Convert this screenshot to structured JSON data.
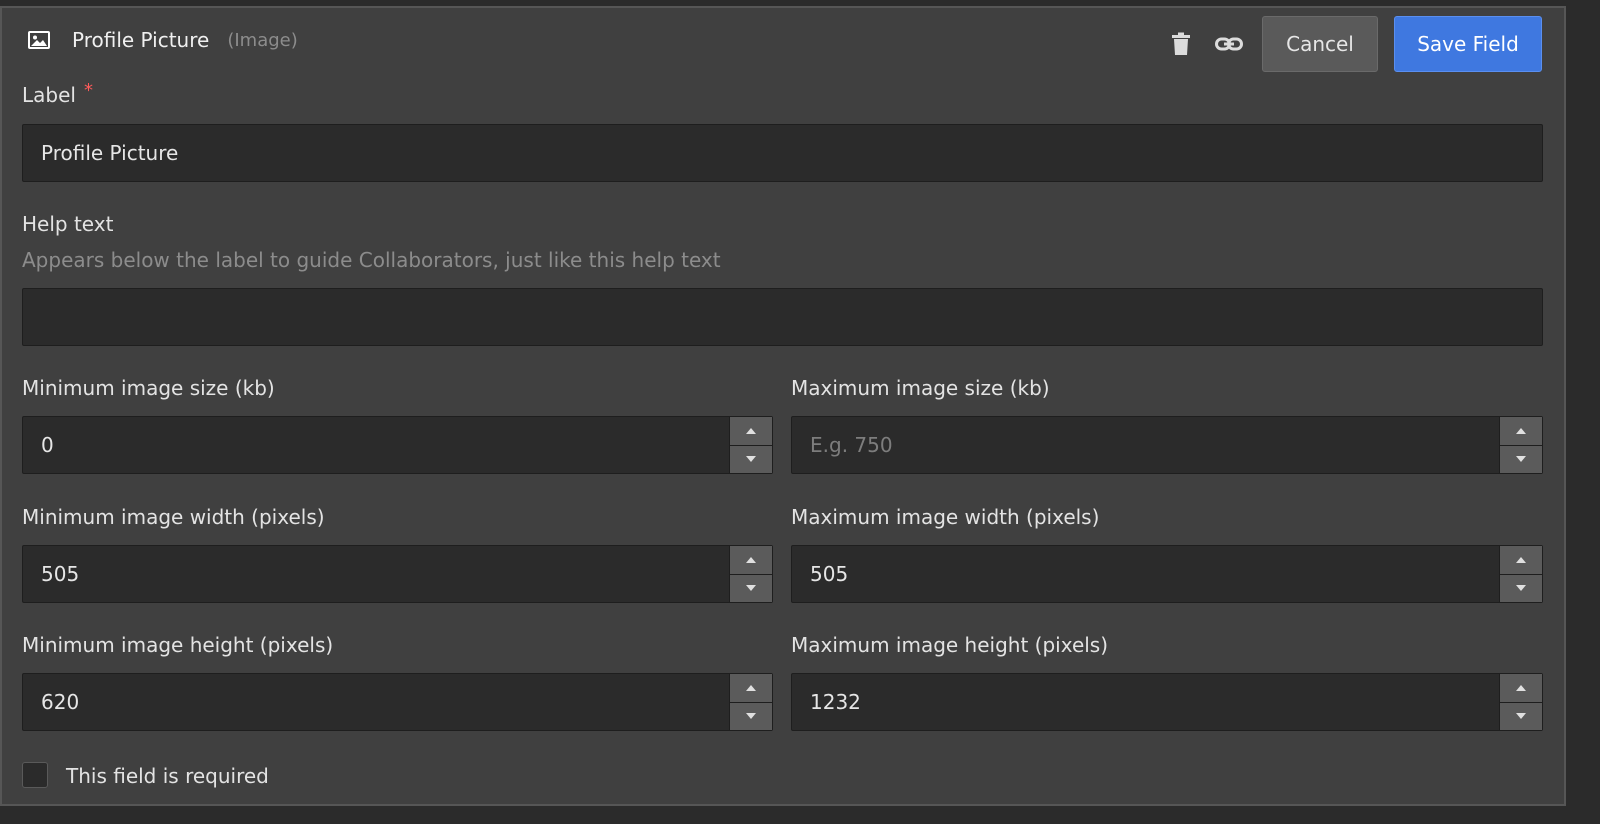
{
  "header": {
    "title": "Profile Picture",
    "type_label": "(Image)",
    "icons": [
      "image-icon",
      "trash-icon",
      "link-icon"
    ]
  },
  "actions": {
    "cancel_label": "Cancel",
    "save_label": "Save Field"
  },
  "form": {
    "label_field": {
      "label": "Label",
      "required_mark": "*",
      "value": "Profile Picture"
    },
    "help_field": {
      "label": "Help text",
      "description": "Appears below the label to guide Collaborators, just like this help text",
      "value": ""
    },
    "min_size": {
      "label": "Minimum image size (kb)",
      "value": "0"
    },
    "max_size": {
      "label": "Maximum image size (kb)",
      "value": "",
      "placeholder": "E.g. 750"
    },
    "min_width": {
      "label": "Minimum image width (pixels)",
      "value": "505"
    },
    "max_width": {
      "label": "Maximum image width (pixels)",
      "value": "505"
    },
    "min_height": {
      "label": "Minimum image height (pixels)",
      "value": "620"
    },
    "max_height": {
      "label": "Maximum image height (pixels)",
      "value": "1232"
    },
    "required_checkbox": {
      "label": "This field is required",
      "checked": false
    }
  },
  "colors": {
    "accent": "#3f78e0",
    "required": "#ff5a5a",
    "panel": "#404040",
    "input_bg": "#2b2b2b"
  }
}
